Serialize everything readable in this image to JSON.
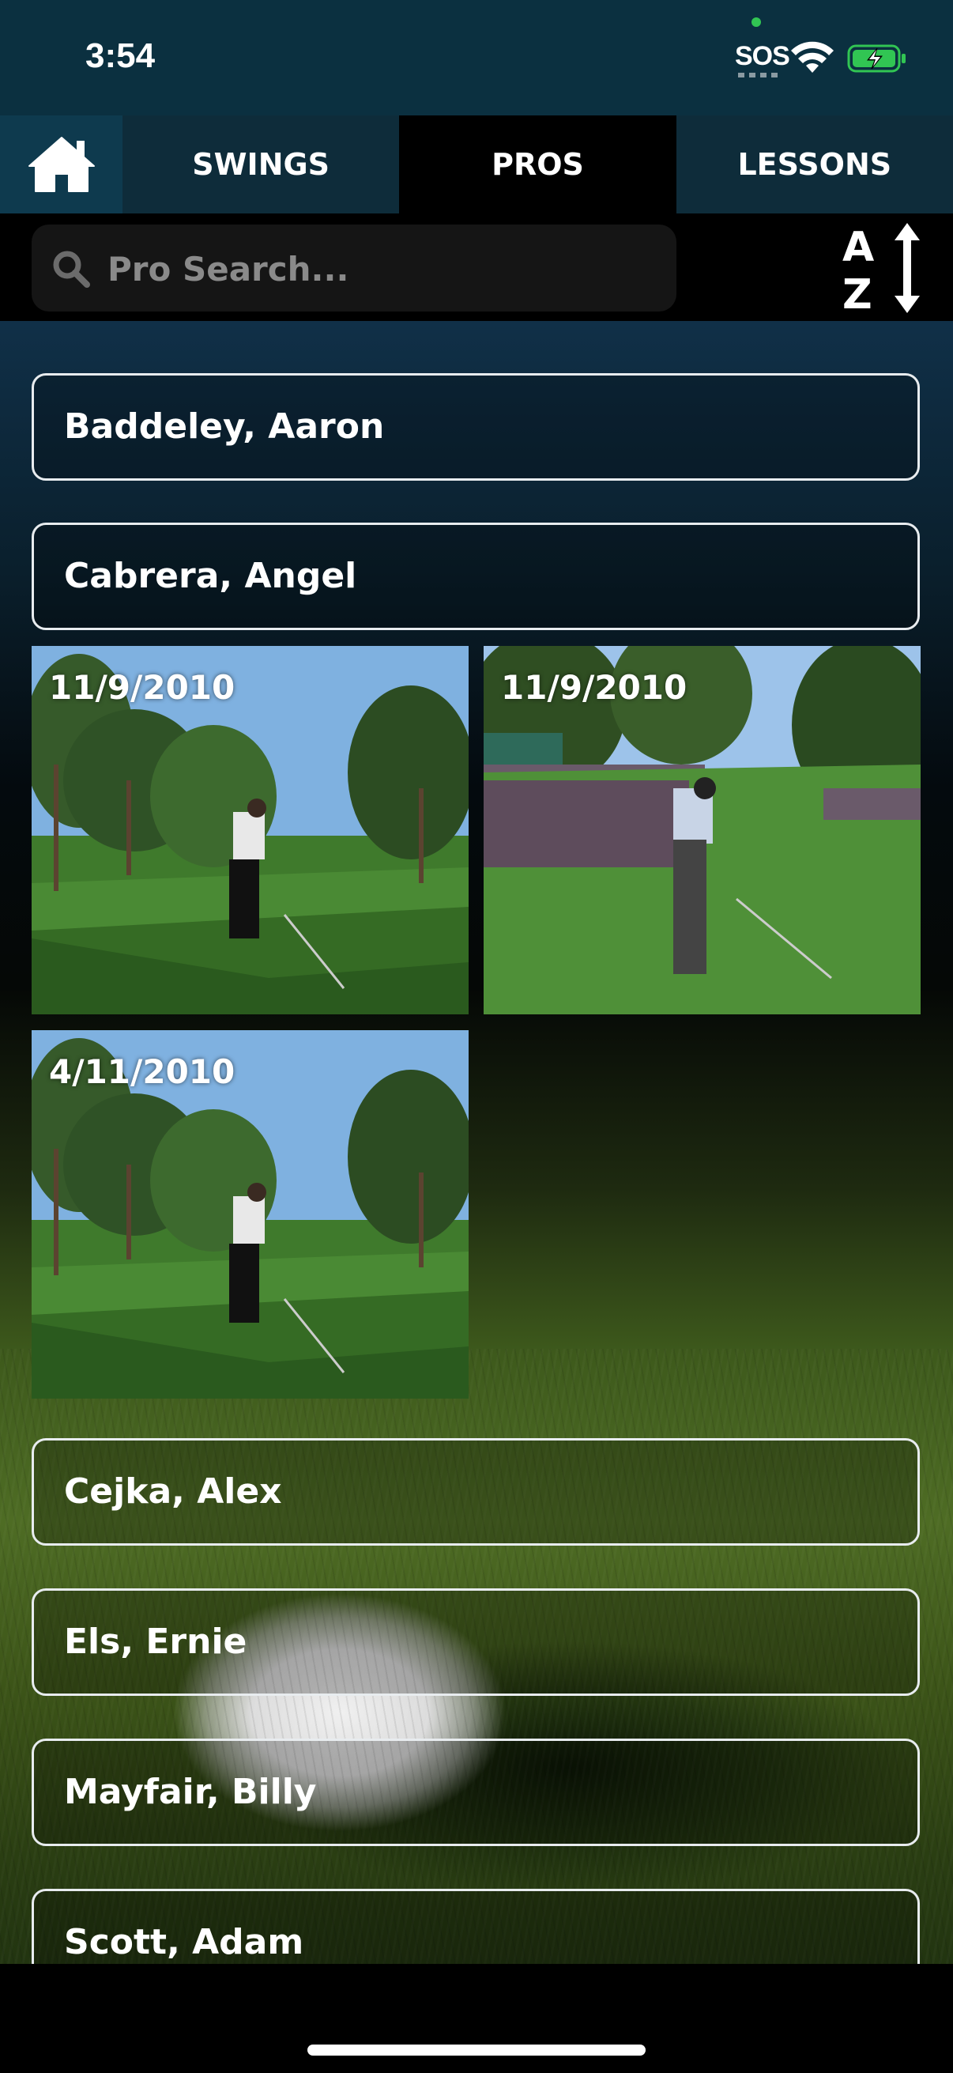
{
  "status_bar": {
    "time": "3:54",
    "sos": "SOS",
    "icons": [
      "wifi-icon",
      "battery-charging-icon"
    ]
  },
  "tabs": {
    "home_icon": "home-icon",
    "items": [
      {
        "label": "SWINGS",
        "active": false
      },
      {
        "label": "PROS",
        "active": true
      },
      {
        "label": "LESSONS",
        "active": false
      }
    ]
  },
  "search": {
    "placeholder": "Pro Search...",
    "value": "",
    "sort_icon": "sort-a-z-icon"
  },
  "pros": [
    {
      "name": "Baddeley, Aaron"
    },
    {
      "name": "Cabrera, Angel",
      "expanded": true,
      "swings": [
        {
          "date": "11/9/2010"
        },
        {
          "date": "11/9/2010"
        },
        {
          "date": "4/11/2010"
        }
      ]
    },
    {
      "name": "Cejka, Alex"
    },
    {
      "name": "Els, Ernie"
    },
    {
      "name": "Mayfair, Billy"
    },
    {
      "name": "Scott, Adam"
    }
  ],
  "colors": {
    "status_bar_bg": "#0b3040",
    "tab_bg": "#0e2c3a",
    "tab_active_bg": "#000000",
    "row_border": "#e8ecef"
  }
}
